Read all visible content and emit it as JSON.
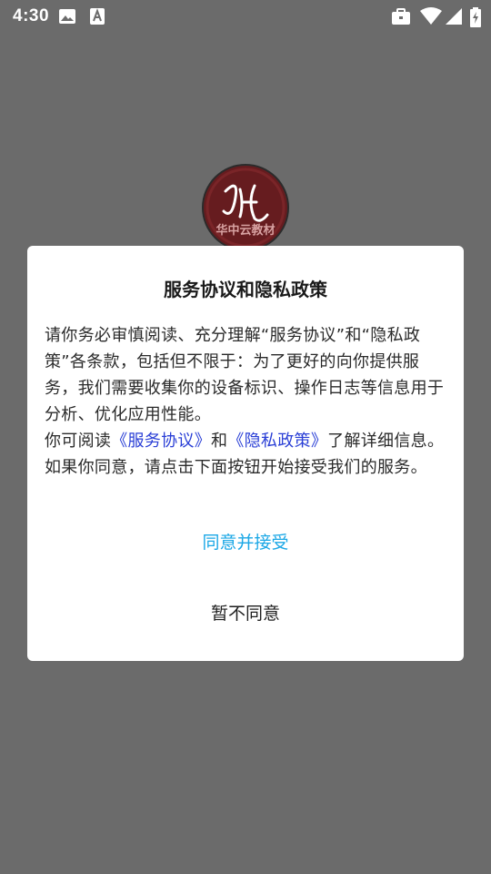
{
  "status_bar": {
    "time": "4:30",
    "icons": [
      "image-icon",
      "a-text-icon",
      "briefcase-icon",
      "wifi-icon",
      "signal-icon",
      "battery-charging-icon"
    ]
  },
  "app": {
    "logo_text": "华中云教材"
  },
  "dialog": {
    "title": "服务协议和隐私政策",
    "paragraph1": "请你务必审慎阅读、充分理解“服务协议”和“隐私政策”各条款，包括但不限于：为了更好的向你提供服务，我们需要收集你的设备标识、操作日志等信息用于分析、优化应用性能。",
    "paragraph2_prefix": "你可阅读",
    "service_link": "《服务协议》",
    "paragraph2_and": "和",
    "privacy_link": "《隐私政策》",
    "paragraph2_suffix": "了解详细信息。如果你同意，请点击下面按钮开始接受我们的服务。",
    "agree_label": "同意并接受",
    "disagree_label": "暂不同意"
  },
  "colors": {
    "background_dim": "#6b6b6b",
    "link": "#2a3fd6",
    "agree": "#1aa7e6",
    "logo_bg": "#661c1f"
  }
}
